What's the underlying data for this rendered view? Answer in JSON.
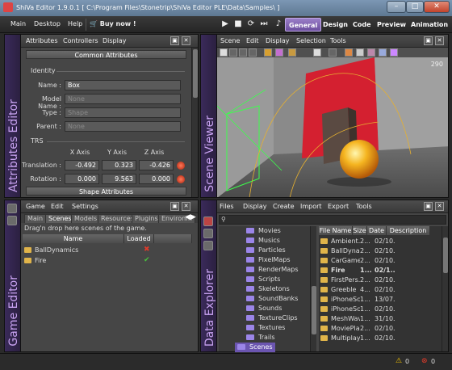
{
  "window": {
    "title": "ShiVa Editor 1.9.0.1 [ C:\\Program Files\\Stonetrip\\ShiVa Editor PLE\\Data\\Samples\\ ]"
  },
  "menubar": {
    "items": [
      "Main",
      "Desktop",
      "Help"
    ],
    "buy_label": "Buy now !",
    "tabs": [
      "General",
      "Design",
      "Code",
      "Preview",
      "Animation"
    ],
    "active_tab": "General"
  },
  "attributes": {
    "menu": [
      "Attributes",
      "Controllers",
      "Display"
    ],
    "section_title": "Common Attributes",
    "identity_label": "Identity",
    "name_label": "Name :",
    "name_value": "Box",
    "model_label": "Model Name :",
    "model_placeholder": "None",
    "type_label": "Type :",
    "type_placeholder": "Shape",
    "parent_label": "Parent :",
    "parent_placeholder": "None",
    "trs_label": "TRS",
    "axes": [
      "X Axis",
      "Y Axis",
      "Z Axis"
    ],
    "translation_label": "Translation :",
    "translation": [
      "-0.492",
      "0.323",
      "-0.426"
    ],
    "rotation_label": "Rotation :",
    "rotation": [
      "0.000",
      "9.563",
      "0.000"
    ],
    "shape_section": "Shape Attributes",
    "sidebar_title": "Attributes Editor"
  },
  "scene_viewer": {
    "menu": [
      "Scene",
      "Edit",
      "Display",
      "Selection",
      "Tools"
    ],
    "sidebar_title": "Scene Viewer",
    "fps": "290"
  },
  "game_editor": {
    "menu": [
      "Game",
      "Edit",
      "Settings"
    ],
    "tabs": [
      "Main",
      "Scenes",
      "Models",
      "Resources",
      "Plugins",
      "Environm"
    ],
    "active_tab": "Scenes",
    "hint": "Drag'n drop here scenes of the game.",
    "columns": [
      "Name",
      "Loaded"
    ],
    "rows": [
      {
        "name": "BallDynamics",
        "loaded": "✖",
        "loaded_color": "#e03a2a"
      },
      {
        "name": "Fire",
        "loaded": "✔",
        "loaded_color": "#48c23c"
      }
    ],
    "sidebar_title": "Game Editor"
  },
  "data_explorer": {
    "menu": [
      "Files",
      "Display",
      "Create",
      "Import",
      "Export",
      "Tools"
    ],
    "tree": [
      "Movies",
      "Musics",
      "Particles",
      "PixelMaps",
      "RenderMaps",
      "Scripts",
      "Skeletons",
      "SoundBanks",
      "Sounds",
      "TextureClips",
      "Textures",
      "Trails"
    ],
    "selected": "Scenes",
    "columns": [
      "File Name",
      "Size",
      "Date",
      "Description"
    ],
    "files": [
      {
        "name": "Ambient...",
        "size": "2...",
        "date": "02/10..."
      },
      {
        "name": "BallDyna...",
        "size": "2...",
        "date": "02/10..."
      },
      {
        "name": "CarGame",
        "size": "2...",
        "date": "02/10..."
      },
      {
        "name": "Fire",
        "size": "1...",
        "date": "02/1..."
      },
      {
        "name": "FirstPers...",
        "size": "2...",
        "date": "02/10..."
      },
      {
        "name": "Greeble",
        "size": "4...",
        "date": "02/10..."
      },
      {
        "name": "iPhoneSc...",
        "size": "1...",
        "date": "13/07..."
      },
      {
        "name": "iPhoneSc...",
        "size": "1...",
        "date": "02/10..."
      },
      {
        "name": "MeshWave",
        "size": "1...",
        "date": "31/10..."
      },
      {
        "name": "MoviePla...",
        "size": "2...",
        "date": "02/10..."
      },
      {
        "name": "Multiplay...",
        "size": "1...",
        "date": "02/10..."
      }
    ],
    "sidebar_title": "Data Explorer"
  },
  "status": {
    "warnings": "0",
    "errors": "0"
  },
  "colors": {
    "accent": "#8e6fc4",
    "sidebar_text": "#c9a3f2",
    "sphere": "#f0b020",
    "wall_red": "#d42030"
  }
}
